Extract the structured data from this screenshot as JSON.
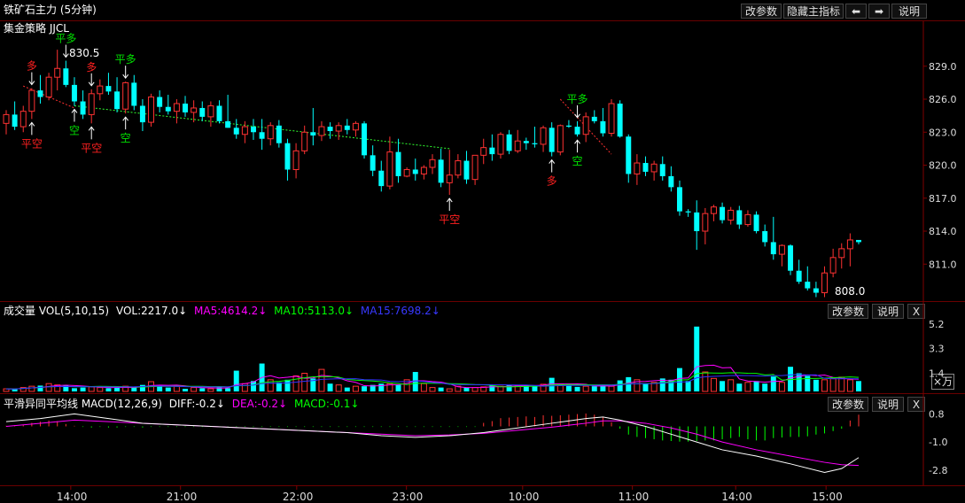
{
  "header": {
    "title": "铁矿石主力 (5分钟)",
    "buttons": {
      "params": "改参数",
      "hide_indicator": "隐藏主指标",
      "prev": "⬅",
      "next": "➡",
      "help": "说明"
    }
  },
  "main_panel": {
    "strategy_label": "集金策略 JJCL",
    "high_label": "830.5",
    "low_label": "808.0"
  },
  "volume_panel": {
    "title": "成交量 VOL(5,10,15)",
    "vol": "VOL:2217.0↓",
    "ma5": "MA5:4614.2↓",
    "ma10": "MA10:5113.0↓",
    "ma15": "MA15:7698.2↓",
    "buttons": {
      "params": "改参数",
      "help": "说明",
      "close": "X"
    },
    "unit": "×万"
  },
  "macd_panel": {
    "title": "平滑异同平均线 MACD(12,26,9)",
    "diff": "DIFF:-0.2↓",
    "dea": "DEA:-0.2↓",
    "macd": "MACD:-0.1↓",
    "buttons": {
      "params": "改参数",
      "help": "说明",
      "close": "X"
    }
  },
  "colors": {
    "up": "#ff3232",
    "down": "#00ffff",
    "ma5": "#ff00ff",
    "ma10": "#00ff00",
    "ma15": "#3030ff",
    "diff": "#ffffff",
    "dea": "#ff00ff",
    "signal_red": "#ff2020",
    "signal_green": "#00e000",
    "grid": "#800000"
  },
  "chart_data": {
    "type": "candlestick",
    "price_axis": {
      "ticks": [
        829.0,
        826.0,
        823.0,
        820.0,
        817.0,
        814.0,
        811.0
      ],
      "ylim": [
        807.8,
        831.8
      ]
    },
    "volume_axis": {
      "ticks": [
        "5.2",
        "3.3",
        "1.4"
      ],
      "ylim": [
        0,
        5.6
      ]
    },
    "macd_axis": {
      "ticks": [
        "0.8",
        "-1.0",
        "-2.8"
      ],
      "ylim": [
        -3.6,
        1.5
      ]
    },
    "time_labels": [
      "14:00",
      "21:00",
      "22:00",
      "23:00",
      "10:00",
      "11:00",
      "14:00",
      "15:00"
    ],
    "candles": [
      [
        823.8,
        825.0,
        822.8,
        824.6
      ],
      [
        824.6,
        825.8,
        823.2,
        823.5
      ],
      [
        823.5,
        825.4,
        823.0,
        824.9
      ],
      [
        824.9,
        827.0,
        824.2,
        826.8
      ],
      [
        826.8,
        828.2,
        825.6,
        826.2
      ],
      [
        826.2,
        828.4,
        825.9,
        828.0
      ],
      [
        828.0,
        830.5,
        826.8,
        828.8
      ],
      [
        828.8,
        829.5,
        827.1,
        827.3
      ],
      [
        827.3,
        828.0,
        825.4,
        825.8
      ],
      [
        825.8,
        826.8,
        824.2,
        824.6
      ],
      [
        824.6,
        826.9,
        823.8,
        826.5
      ],
      [
        826.5,
        827.8,
        825.9,
        827.2
      ],
      [
        827.2,
        828.4,
        826.4,
        826.7
      ],
      [
        826.7,
        828.0,
        824.8,
        825.1
      ],
      [
        825.1,
        827.6,
        824.7,
        827.5
      ],
      [
        827.5,
        828.2,
        825.0,
        825.4
      ],
      [
        825.4,
        826.0,
        823.1,
        823.9
      ],
      [
        823.9,
        826.5,
        823.5,
        826.2
      ],
      [
        826.2,
        826.8,
        824.8,
        825.3
      ],
      [
        825.3,
        826.4,
        824.6,
        824.9
      ],
      [
        824.9,
        826.0,
        823.8,
        825.6
      ],
      [
        825.6,
        826.3,
        824.4,
        824.8
      ],
      [
        824.8,
        825.9,
        823.9,
        825.2
      ],
      [
        825.2,
        825.8,
        824.0,
        824.4
      ],
      [
        824.4,
        825.8,
        823.5,
        825.4
      ],
      [
        825.4,
        825.9,
        823.8,
        824.0
      ],
      [
        824.0,
        826.4,
        823.4,
        823.4
      ],
      [
        823.4,
        824.2,
        822.4,
        822.8
      ],
      [
        822.8,
        824.0,
        822.0,
        823.5
      ],
      [
        823.5,
        824.2,
        822.3,
        823.0
      ],
      [
        823.0,
        824.2,
        821.4,
        822.4
      ],
      [
        822.4,
        823.9,
        821.8,
        823.6
      ],
      [
        823.6,
        824.1,
        821.6,
        822.0
      ],
      [
        822.0,
        822.4,
        818.6,
        819.6
      ],
      [
        819.6,
        822.0,
        818.8,
        821.3
      ],
      [
        821.3,
        823.6,
        821.0,
        823.0
      ],
      [
        823.0,
        825.2,
        821.8,
        822.7
      ],
      [
        822.7,
        824.0,
        822.2,
        823.5
      ],
      [
        823.5,
        823.9,
        822.4,
        823.1
      ],
      [
        823.1,
        823.9,
        822.3,
        823.6
      ],
      [
        823.6,
        824.2,
        822.8,
        823.2
      ],
      [
        823.2,
        824.0,
        822.6,
        823.8
      ],
      [
        823.8,
        824.0,
        820.6,
        820.9
      ],
      [
        820.9,
        821.8,
        819.0,
        819.5
      ],
      [
        819.5,
        820.4,
        817.6,
        818.1
      ],
      [
        818.1,
        822.6,
        817.8,
        821.2
      ],
      [
        821.2,
        822.4,
        818.4,
        819.0
      ],
      [
        819.0,
        819.8,
        818.9,
        819.6
      ],
      [
        819.6,
        820.6,
        818.6,
        819.2
      ],
      [
        819.2,
        820.0,
        818.7,
        819.8
      ],
      [
        819.8,
        821.0,
        819.2,
        820.5
      ],
      [
        820.5,
        821.5,
        818.0,
        818.4
      ],
      [
        818.4,
        821.4,
        817.3,
        819.1
      ],
      [
        819.1,
        821.0,
        818.8,
        820.4
      ],
      [
        820.4,
        821.3,
        818.3,
        818.7
      ],
      [
        818.7,
        820.8,
        818.2,
        820.9
      ],
      [
        820.9,
        822.4,
        820.1,
        821.6
      ],
      [
        821.6,
        822.8,
        820.4,
        821.0
      ],
      [
        821.0,
        823.0,
        820.6,
        822.8
      ],
      [
        822.8,
        823.2,
        821.0,
        821.3
      ],
      [
        821.3,
        823.2,
        821.1,
        822.2
      ],
      [
        822.2,
        822.5,
        821.4,
        822.0
      ],
      [
        822.0,
        823.5,
        821.6,
        821.9
      ],
      [
        821.9,
        823.6,
        821.2,
        823.4
      ],
      [
        823.4,
        823.9,
        820.8,
        821.2
      ],
      [
        821.2,
        823.7,
        820.9,
        823.6
      ],
      [
        823.6,
        824.1,
        823.4,
        823.5
      ],
      [
        823.5,
        824.0,
        822.6,
        822.8
      ],
      [
        822.8,
        824.8,
        822.1,
        824.4
      ],
      [
        824.4,
        825.0,
        823.8,
        824.0
      ],
      [
        824.0,
        825.2,
        822.6,
        822.9
      ],
      [
        822.9,
        826.0,
        822.6,
        825.6
      ],
      [
        825.6,
        825.9,
        822.5,
        822.6
      ],
      [
        822.6,
        822.8,
        818.4,
        819.2
      ],
      [
        819.2,
        821.0,
        818.2,
        820.2
      ],
      [
        820.2,
        820.8,
        819.0,
        819.4
      ],
      [
        819.4,
        820.4,
        818.6,
        820.1
      ],
      [
        820.1,
        820.8,
        818.6,
        819.0
      ],
      [
        819.0,
        819.9,
        817.6,
        818.0
      ],
      [
        818.0,
        818.6,
        815.4,
        815.8
      ],
      [
        815.8,
        816.0,
        815.3,
        815.7
      ],
      [
        815.7,
        816.8,
        812.3,
        814.0
      ],
      [
        814.0,
        816.1,
        812.8,
        815.6
      ],
      [
        815.6,
        816.4,
        814.9,
        816.2
      ],
      [
        816.2,
        816.6,
        814.7,
        815.0
      ],
      [
        815.0,
        816.2,
        814.6,
        815.9
      ],
      [
        815.9,
        816.3,
        814.2,
        814.6
      ],
      [
        814.6,
        815.9,
        814.4,
        815.5
      ],
      [
        815.5,
        815.8,
        813.8,
        814.0
      ],
      [
        814.0,
        814.6,
        812.6,
        813.0
      ],
      [
        813.0,
        815.3,
        811.4,
        811.9
      ],
      [
        811.9,
        812.8,
        810.8,
        812.7
      ],
      [
        812.7,
        812.8,
        810.0,
        810.4
      ],
      [
        810.4,
        811.4,
        809.2,
        809.4
      ],
      [
        809.4,
        810.8,
        808.6,
        808.8
      ],
      [
        808.8,
        809.4,
        808.0,
        808.4
      ],
      [
        808.4,
        810.8,
        808.0,
        810.2
      ],
      [
        810.2,
        812.4,
        809.8,
        811.6
      ],
      [
        811.6,
        812.9,
        810.6,
        812.4
      ],
      [
        812.4,
        813.8,
        810.8,
        813.2
      ],
      [
        813.2,
        813.2,
        812.8,
        813.0
      ]
    ],
    "volume": [
      0.2,
      0.18,
      0.3,
      0.4,
      0.45,
      0.6,
      0.5,
      0.45,
      0.25,
      0.3,
      0.35,
      0.3,
      0.25,
      0.3,
      0.4,
      0.3,
      0.5,
      0.75,
      0.5,
      0.3,
      0.4,
      0.2,
      0.3,
      0.25,
      0.2,
      0.35,
      0.25,
      1.6,
      0.6,
      0.8,
      2.15,
      0.9,
      0.7,
      0.9,
      1.2,
      1.4,
      1.0,
      1.7,
      0.6,
      0.5,
      0.3,
      0.4,
      0.4,
      0.5,
      0.6,
      0.6,
      0.5,
      0.9,
      1.5,
      0.6,
      0.3,
      0.3,
      0.2,
      0.4,
      0.3,
      0.3,
      0.35,
      0.45,
      0.4,
      0.5,
      0.45,
      0.5,
      0.4,
      0.55,
      1.05,
      0.45,
      0.5,
      0.35,
      0.4,
      0.4,
      0.5,
      0.4,
      0.85,
      1.1,
      0.9,
      0.6,
      0.7,
      1.0,
      0.9,
      1.8,
      0.8,
      5.0,
      1.5,
      1.0,
      0.8,
      0.9,
      0.6,
      0.7,
      0.8,
      0.6,
      1.15,
      0.7,
      1.9,
      1.4,
      1.2,
      0.9,
      0.9,
      1.0,
      1.1,
      0.9,
      0.8
    ],
    "macd_bars": [
      0.05,
      0.1,
      0.15,
      0.3,
      0.4,
      0.5,
      0.45,
      0.2,
      0.05,
      -0.05,
      -0.1,
      -0.05,
      -0.1,
      -0.1,
      -0.05,
      -0.05,
      -0.1,
      -0.05,
      -0.05,
      -0.05,
      -0.05,
      -0.05,
      -0.05,
      -0.05,
      -0.05,
      -0.05,
      -0.05,
      -0.05,
      -0.05,
      -0.05,
      -0.05,
      -0.05,
      -0.05,
      -0.05,
      -0.05,
      -0.05,
      -0.05,
      -0.05,
      -0.05,
      -0.05,
      -0.05,
      -0.05,
      -0.05,
      -0.05,
      -0.05,
      -0.05,
      -0.05,
      -0.05,
      -0.05,
      -0.05,
      -0.05,
      -0.05,
      -0.05,
      -0.05,
      -0.05,
      -0.05,
      0.3,
      0.45,
      0.7,
      0.75,
      0.8,
      0.85,
      0.8,
      0.95,
      0.9,
      0.95,
      1.0,
      1.05,
      1.1,
      1.0,
      0.8,
      0.35,
      -0.2,
      -0.7,
      -0.9,
      -1.0,
      -1.1,
      -1.2,
      -1.25,
      -1.3,
      -1.3,
      -1.25,
      -1.2,
      -1.2,
      -1.1,
      -1.0,
      -0.9,
      -1.1,
      -1.2,
      -1.2,
      -1.0,
      -0.95,
      -0.9,
      -0.9,
      -0.85,
      -0.7,
      -0.6,
      -0.4,
      -0.2,
      0.5,
      1.0
    ],
    "diff_points": [
      [
        0,
        0.3
      ],
      [
        4,
        0.5
      ],
      [
        8,
        0.8
      ],
      [
        12,
        0.5
      ],
      [
        16,
        0.2
      ],
      [
        20,
        0.1
      ],
      [
        24,
        0.0
      ],
      [
        28,
        -0.1
      ],
      [
        32,
        -0.2
      ],
      [
        36,
        -0.3
      ],
      [
        40,
        -0.4
      ],
      [
        44,
        -0.6
      ],
      [
        48,
        -0.7
      ],
      [
        52,
        -0.6
      ],
      [
        56,
        -0.4
      ],
      [
        60,
        -0.1
      ],
      [
        64,
        0.2
      ],
      [
        68,
        0.5
      ],
      [
        70,
        0.6
      ],
      [
        72,
        0.4
      ],
      [
        75,
        0.0
      ],
      [
        78,
        -0.5
      ],
      [
        81,
        -1.0
      ],
      [
        84,
        -1.5
      ],
      [
        88,
        -1.9
      ],
      [
        92,
        -2.4
      ],
      [
        96,
        -2.95
      ],
      [
        98,
        -2.7
      ],
      [
        100,
        -2.0
      ]
    ],
    "dea_points": [
      [
        0,
        0.0
      ],
      [
        4,
        0.2
      ],
      [
        8,
        0.4
      ],
      [
        12,
        0.3
      ],
      [
        16,
        0.2
      ],
      [
        20,
        0.1
      ],
      [
        24,
        0.0
      ],
      [
        28,
        -0.1
      ],
      [
        32,
        -0.2
      ],
      [
        36,
        -0.3
      ],
      [
        40,
        -0.4
      ],
      [
        44,
        -0.5
      ],
      [
        48,
        -0.6
      ],
      [
        52,
        -0.55
      ],
      [
        56,
        -0.45
      ],
      [
        60,
        -0.25
      ],
      [
        64,
        -0.05
      ],
      [
        68,
        0.2
      ],
      [
        70,
        0.35
      ],
      [
        72,
        0.35
      ],
      [
        75,
        0.2
      ],
      [
        78,
        -0.1
      ],
      [
        81,
        -0.5
      ],
      [
        84,
        -1.0
      ],
      [
        88,
        -1.5
      ],
      [
        92,
        -1.9
      ],
      [
        96,
        -2.3
      ],
      [
        98,
        -2.45
      ],
      [
        100,
        -2.5
      ]
    ],
    "dashed_segments": [
      {
        "color": "red",
        "points": [
          [
            2,
            827.2
          ],
          [
            8,
            825.2
          ]
        ]
      },
      {
        "color": "green",
        "points": [
          [
            8,
            825.4
          ],
          [
            52,
            821.5
          ]
        ]
      },
      {
        "color": "red",
        "points": [
          [
            65,
            826.0
          ],
          [
            71,
            821.0
          ]
        ]
      }
    ],
    "signals": [
      {
        "i": 3,
        "text": "多",
        "dir": "down",
        "color": "red"
      },
      {
        "i": 3,
        "text": "平空",
        "dir": "up",
        "color": "red"
      },
      {
        "i": 7,
        "text": "平多",
        "dir": "down",
        "color": "green"
      },
      {
        "i": 8,
        "text": "空",
        "dir": "up",
        "color": "green"
      },
      {
        "i": 10,
        "text": "平空",
        "dir": "up",
        "color": "red"
      },
      {
        "i": 10,
        "text": "多",
        "dir": "down",
        "color": "red"
      },
      {
        "i": 14,
        "text": "平多",
        "dir": "down",
        "color": "green"
      },
      {
        "i": 14,
        "text": "空",
        "dir": "up",
        "color": "green"
      },
      {
        "i": 52,
        "text": "平空",
        "dir": "up",
        "color": "red"
      },
      {
        "i": 64,
        "text": "多",
        "dir": "up",
        "color": "red"
      },
      {
        "i": 67,
        "text": "平多",
        "dir": "down",
        "color": "green"
      },
      {
        "i": 67,
        "text": "空",
        "dir": "up",
        "color": "green"
      }
    ]
  }
}
